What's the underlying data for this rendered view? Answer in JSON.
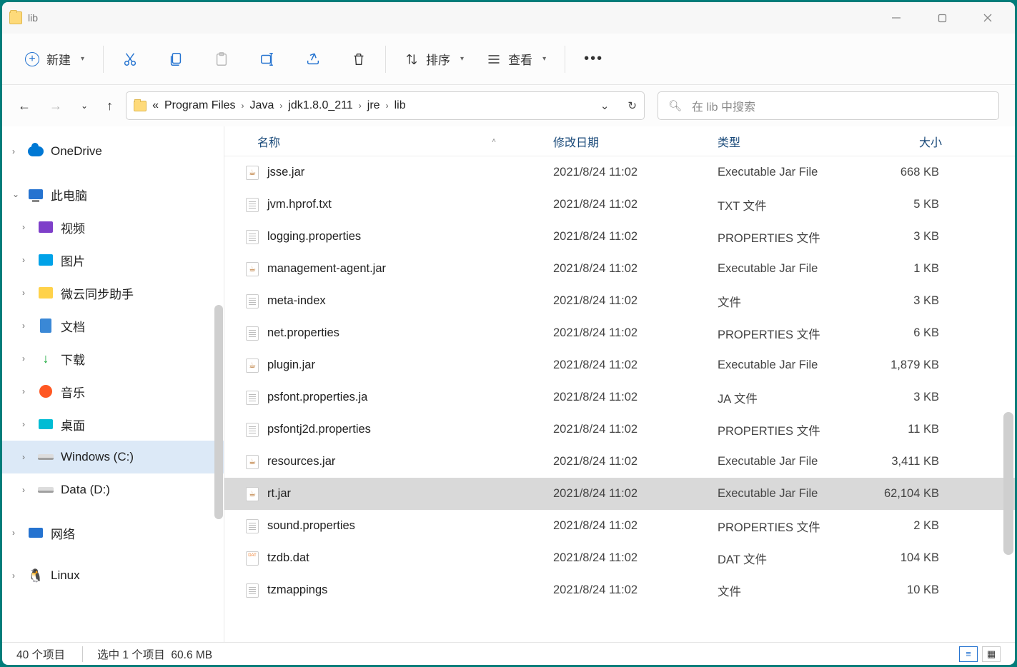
{
  "window": {
    "title": "lib"
  },
  "toolbar": {
    "new": "新建",
    "sort": "排序",
    "view": "查看"
  },
  "breadcrumbs": {
    "prefix": "«",
    "items": [
      "Program Files",
      "Java",
      "jdk1.8.0_211",
      "jre",
      "lib"
    ]
  },
  "search": {
    "placeholder": "在 lib 中搜索"
  },
  "sidebar": {
    "onedrive": "OneDrive",
    "thispc": "此电脑",
    "video": "视频",
    "pictures": "图片",
    "weiyun": "微云同步助手",
    "documents": "文档",
    "downloads": "下载",
    "music": "音乐",
    "desktop": "桌面",
    "cdrive": "Windows (C:)",
    "ddrive": "Data (D:)",
    "network": "网络",
    "linux": "Linux"
  },
  "columns": {
    "name": "名称",
    "modified": "修改日期",
    "type": "类型",
    "size": "大小"
  },
  "files": [
    {
      "name": "jsse.jar",
      "date": "2021/8/24 11:02",
      "type": "Executable Jar File",
      "size": "668 KB",
      "icon": "jar"
    },
    {
      "name": "jvm.hprof.txt",
      "date": "2021/8/24 11:02",
      "type": "TXT 文件",
      "size": "5 KB",
      "icon": "txt"
    },
    {
      "name": "logging.properties",
      "date": "2021/8/24 11:02",
      "type": "PROPERTIES 文件",
      "size": "3 KB",
      "icon": "txt"
    },
    {
      "name": "management-agent.jar",
      "date": "2021/8/24 11:02",
      "type": "Executable Jar File",
      "size": "1 KB",
      "icon": "jar"
    },
    {
      "name": "meta-index",
      "date": "2021/8/24 11:02",
      "type": "文件",
      "size": "3 KB",
      "icon": "txt"
    },
    {
      "name": "net.properties",
      "date": "2021/8/24 11:02",
      "type": "PROPERTIES 文件",
      "size": "6 KB",
      "icon": "txt"
    },
    {
      "name": "plugin.jar",
      "date": "2021/8/24 11:02",
      "type": "Executable Jar File",
      "size": "1,879 KB",
      "icon": "jar"
    },
    {
      "name": "psfont.properties.ja",
      "date": "2021/8/24 11:02",
      "type": "JA 文件",
      "size": "3 KB",
      "icon": "txt"
    },
    {
      "name": "psfontj2d.properties",
      "date": "2021/8/24 11:02",
      "type": "PROPERTIES 文件",
      "size": "11 KB",
      "icon": "txt"
    },
    {
      "name": "resources.jar",
      "date": "2021/8/24 11:02",
      "type": "Executable Jar File",
      "size": "3,411 KB",
      "icon": "jar"
    },
    {
      "name": "rt.jar",
      "date": "2021/8/24 11:02",
      "type": "Executable Jar File",
      "size": "62,104 KB",
      "icon": "jar",
      "selected": true
    },
    {
      "name": "sound.properties",
      "date": "2021/8/24 11:02",
      "type": "PROPERTIES 文件",
      "size": "2 KB",
      "icon": "txt"
    },
    {
      "name": "tzdb.dat",
      "date": "2021/8/24 11:02",
      "type": "DAT 文件",
      "size": "104 KB",
      "icon": "dat"
    },
    {
      "name": "tzmappings",
      "date": "2021/8/24 11:02",
      "type": "文件",
      "size": "10 KB",
      "icon": "txt"
    }
  ],
  "status": {
    "items": "40 个项目",
    "selected": "选中 1 个项目",
    "size": "60.6 MB"
  }
}
